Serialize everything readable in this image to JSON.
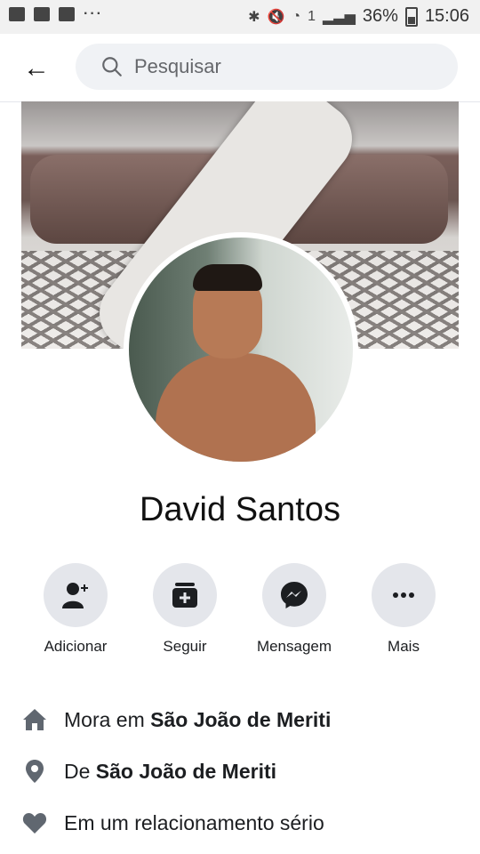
{
  "status_bar": {
    "battery": "36%",
    "time": "15:06",
    "sim": "1",
    "dots": "···"
  },
  "header": {
    "back_label": "←",
    "search_placeholder": "Pesquisar"
  },
  "profile": {
    "name": "David Santos"
  },
  "actions": [
    {
      "label": "Adicionar",
      "icon": "add-friend-icon"
    },
    {
      "label": "Seguir",
      "icon": "follow-icon"
    },
    {
      "label": "Mensagem",
      "icon": "messenger-icon"
    },
    {
      "label": "Mais",
      "icon": "more-icon"
    }
  ],
  "info": {
    "lives": {
      "prefix": "Mora em ",
      "place": "São João de Meriti",
      "icon": "home-icon"
    },
    "from": {
      "prefix": "De ",
      "place": "São João de Meriti",
      "icon": "location-pin-icon"
    },
    "relationship": {
      "text": "Em um relacionamento sério",
      "icon": "heart-icon"
    }
  },
  "colors": {
    "icon_gray": "#606770",
    "circle_bg": "#e4e6eb",
    "search_bg": "#f0f2f5"
  }
}
